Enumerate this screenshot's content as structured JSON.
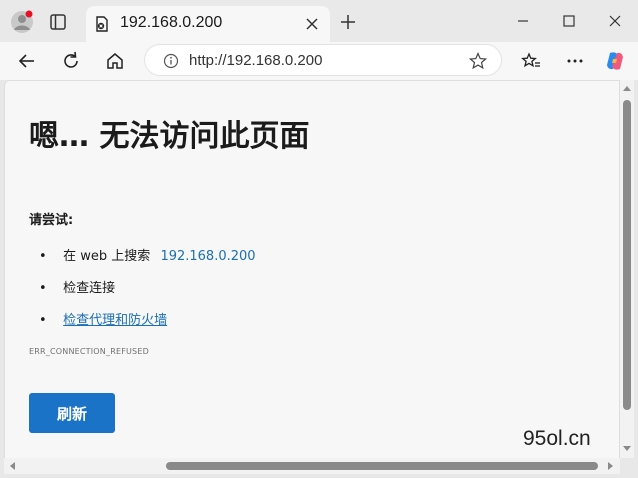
{
  "tab": {
    "title": "192.168.0.200"
  },
  "address": {
    "url": "http://192.168.0.200"
  },
  "icons": {
    "profile": "profile-avatar-icon",
    "tabs": "tab-actions-icon",
    "favicon": "document-error-icon",
    "close": "close-icon",
    "newtab": "plus-icon",
    "back": "back-arrow-icon",
    "reload": "reload-icon",
    "home": "home-icon",
    "info": "info-icon",
    "star": "star-icon",
    "favorites": "favorites-icon",
    "more": "more-icon",
    "copilot": "copilot-icon",
    "minimize": "minimize-icon",
    "maximize": "maximize-icon",
    "window_close": "window-close-icon"
  },
  "error": {
    "heading": "嗯… 无法访问此页面",
    "try_label": "请尝试:",
    "suggestions": [
      {
        "prefix": "在 web 上搜索",
        "link": "192.168.0.200"
      },
      {
        "text": "检查连接"
      },
      {
        "link": "检查代理和防火墙"
      }
    ],
    "code": "ERR_CONNECTION_REFUSED",
    "refresh_label": "刷新"
  },
  "watermark": "95ol.cn",
  "colors": {
    "accent": "#1a73c6",
    "link": "#1a6fb5",
    "notification_dot": "#e81123"
  }
}
